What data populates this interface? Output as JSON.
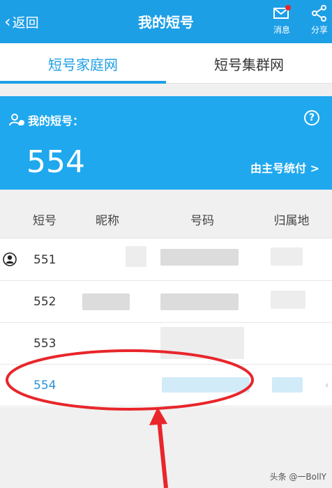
{
  "header": {
    "back_label": "返回",
    "title": "我的短号",
    "actions": [
      {
        "label": "消息",
        "icon": "mail-icon"
      },
      {
        "label": "分享",
        "icon": "share-icon"
      }
    ],
    "bg_color": "#1d9fe6"
  },
  "tabs": [
    {
      "label": "短号家庭网",
      "active": true
    },
    {
      "label": "短号集群网",
      "active": false
    }
  ],
  "card": {
    "title": "我的短号：",
    "number": "554",
    "pay_link": "由主号统付 >",
    "help_icon": "?"
  },
  "table": {
    "headers": [
      "短号",
      "昵称",
      "号码",
      "归属地"
    ],
    "rows": [
      {
        "short": "551",
        "owner": true
      },
      {
        "short": "552",
        "owner": false
      },
      {
        "short": "553",
        "owner": false
      },
      {
        "short": "554",
        "owner": false,
        "highlighted": true
      }
    ]
  },
  "watermark": "头条 @一BollY"
}
